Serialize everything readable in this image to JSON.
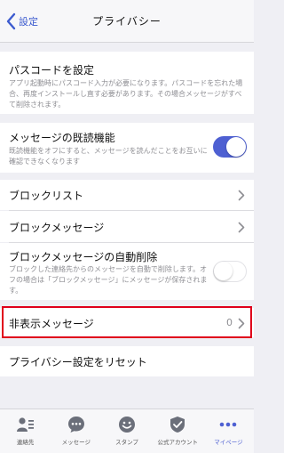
{
  "navbar": {
    "back_label": "設定",
    "title": "プライバシー"
  },
  "passcode": {
    "title": "パスコードを設定",
    "description": "アプリ起動時にパスコード入力が必要になります。パスコードを忘れた場合、再度インストールし直す必要があります。その場合メッセージがすべて削除されます。"
  },
  "read_receipt": {
    "title": "メッセージの既読機能",
    "description": "既読機能をオフにすると、メッセージを読んだことをお互いに確認できなくなります",
    "enabled": true
  },
  "block_list": {
    "title": "ブロックリスト"
  },
  "block_messages": {
    "title": "ブロックメッセージ"
  },
  "auto_delete": {
    "title": "ブロックメッセージの自動削除",
    "description": "ブロックした連絡先からのメッセージを自動で削除します。オフの場合は「ブロックメッセージ」にメッセージが保存されます。",
    "enabled": false
  },
  "hidden_messages": {
    "title": "非表示メッセージ",
    "count": "0"
  },
  "reset": {
    "title": "プライバシー設定をリセット"
  },
  "tabbar": {
    "tabs": [
      {
        "label": "連絡先",
        "icon": "contacts-icon"
      },
      {
        "label": "メッセージ",
        "icon": "message-icon"
      },
      {
        "label": "スタンプ",
        "icon": "sticker-icon"
      },
      {
        "label": "公式アカウント",
        "icon": "official-account-icon"
      },
      {
        "label": "マイページ",
        "icon": "more-icon"
      }
    ],
    "active_index": 4
  },
  "colors": {
    "accent": "#4e60d2",
    "highlight": "#e0001b",
    "background": "#efeff4"
  }
}
